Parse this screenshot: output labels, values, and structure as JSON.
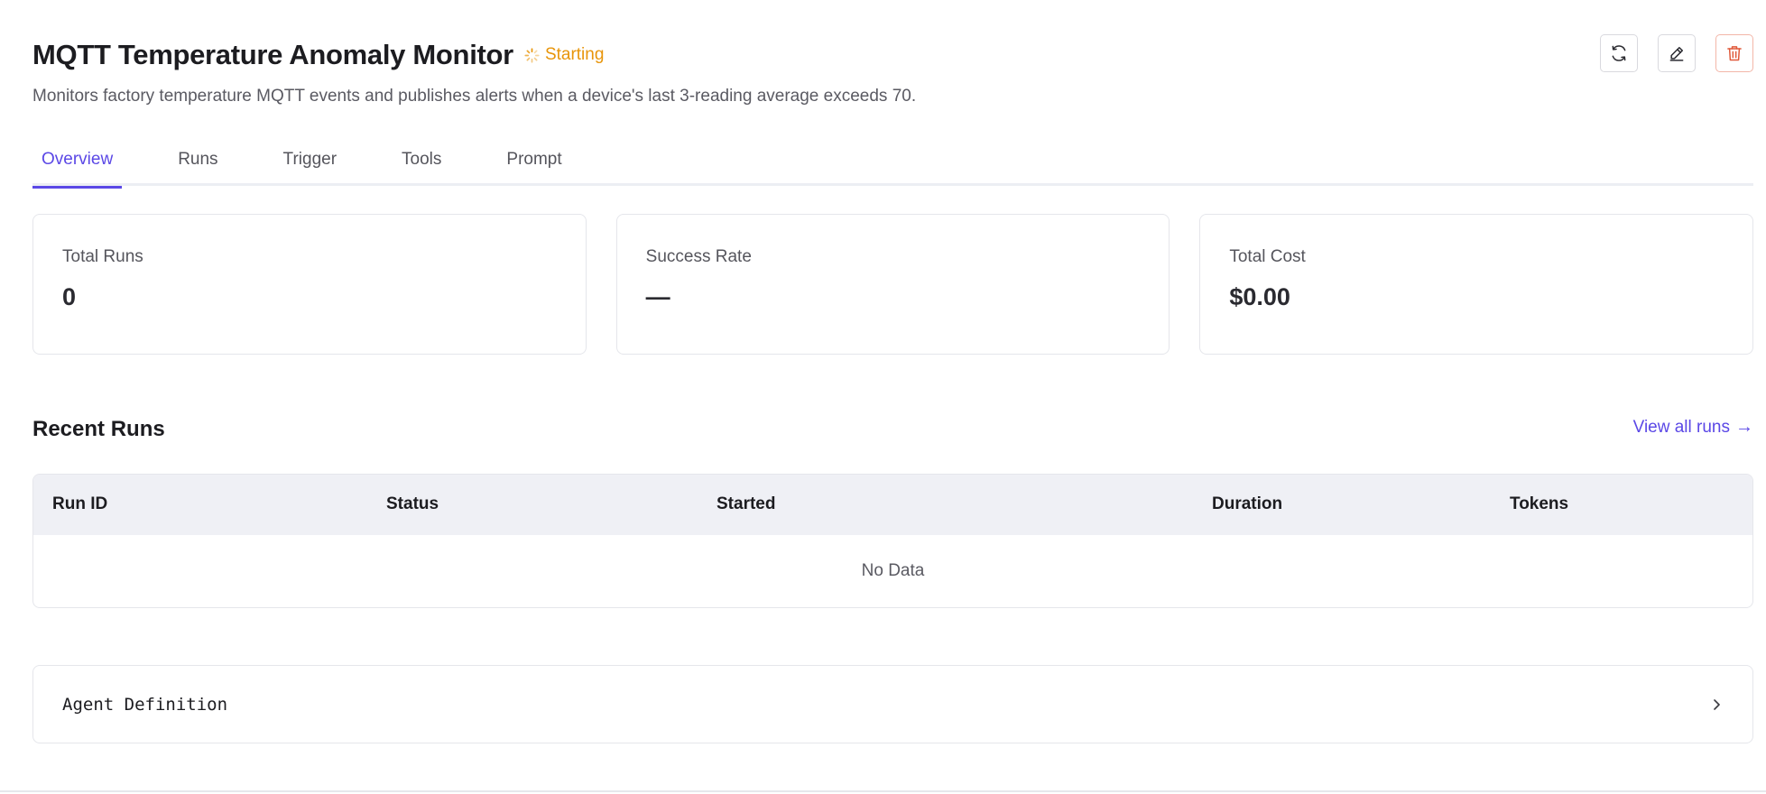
{
  "header": {
    "title": "MQTT Temperature Anomaly Monitor",
    "status": "Starting",
    "description": "Monitors factory temperature MQTT events and publishes alerts when a device's last 3-reading average exceeds 70."
  },
  "colors": {
    "accent": "#5b48e6",
    "status_starting": "#e8950a",
    "danger": "#e0593a"
  },
  "actions": {
    "refresh_icon": "refresh-icon",
    "edit_icon": "pencil-icon",
    "delete_icon": "trash-icon"
  },
  "tabs": [
    {
      "label": "Overview",
      "active": true
    },
    {
      "label": "Runs",
      "active": false
    },
    {
      "label": "Trigger",
      "active": false
    },
    {
      "label": "Tools",
      "active": false
    },
    {
      "label": "Prompt",
      "active": false
    }
  ],
  "stats": [
    {
      "label": "Total Runs",
      "value": "0"
    },
    {
      "label": "Success Rate",
      "value": "—"
    },
    {
      "label": "Total Cost",
      "value": "$0.00"
    }
  ],
  "recent_runs": {
    "title": "Recent Runs",
    "view_all": "View all runs",
    "columns": [
      "Run ID",
      "Status",
      "Started",
      "Duration",
      "Tokens"
    ],
    "empty": "No Data"
  },
  "agent_definition": {
    "label": "Agent Definition"
  }
}
